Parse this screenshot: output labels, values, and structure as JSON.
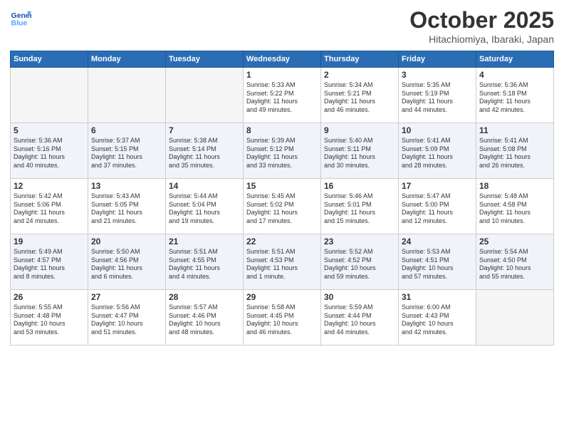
{
  "header": {
    "logo_line1": "General",
    "logo_line2": "Blue",
    "month": "October 2025",
    "location": "Hitachiomiya, Ibaraki, Japan"
  },
  "days_of_week": [
    "Sunday",
    "Monday",
    "Tuesday",
    "Wednesday",
    "Thursday",
    "Friday",
    "Saturday"
  ],
  "weeks": [
    {
      "shade": "white",
      "days": [
        {
          "num": "",
          "text": "",
          "empty": true
        },
        {
          "num": "",
          "text": "",
          "empty": true
        },
        {
          "num": "",
          "text": "",
          "empty": true
        },
        {
          "num": "1",
          "text": "Sunrise: 5:33 AM\nSunset: 5:22 PM\nDaylight: 11 hours\nand 49 minutes."
        },
        {
          "num": "2",
          "text": "Sunrise: 5:34 AM\nSunset: 5:21 PM\nDaylight: 11 hours\nand 46 minutes."
        },
        {
          "num": "3",
          "text": "Sunrise: 5:35 AM\nSunset: 5:19 PM\nDaylight: 11 hours\nand 44 minutes."
        },
        {
          "num": "4",
          "text": "Sunrise: 5:36 AM\nSunset: 5:18 PM\nDaylight: 11 hours\nand 42 minutes."
        }
      ]
    },
    {
      "shade": "shaded",
      "days": [
        {
          "num": "5",
          "text": "Sunrise: 5:36 AM\nSunset: 5:16 PM\nDaylight: 11 hours\nand 40 minutes."
        },
        {
          "num": "6",
          "text": "Sunrise: 5:37 AM\nSunset: 5:15 PM\nDaylight: 11 hours\nand 37 minutes."
        },
        {
          "num": "7",
          "text": "Sunrise: 5:38 AM\nSunset: 5:14 PM\nDaylight: 11 hours\nand 35 minutes."
        },
        {
          "num": "8",
          "text": "Sunrise: 5:39 AM\nSunset: 5:12 PM\nDaylight: 11 hours\nand 33 minutes."
        },
        {
          "num": "9",
          "text": "Sunrise: 5:40 AM\nSunset: 5:11 PM\nDaylight: 11 hours\nand 30 minutes."
        },
        {
          "num": "10",
          "text": "Sunrise: 5:41 AM\nSunset: 5:09 PM\nDaylight: 11 hours\nand 28 minutes."
        },
        {
          "num": "11",
          "text": "Sunrise: 5:41 AM\nSunset: 5:08 PM\nDaylight: 11 hours\nand 26 minutes."
        }
      ]
    },
    {
      "shade": "white",
      "days": [
        {
          "num": "12",
          "text": "Sunrise: 5:42 AM\nSunset: 5:06 PM\nDaylight: 11 hours\nand 24 minutes."
        },
        {
          "num": "13",
          "text": "Sunrise: 5:43 AM\nSunset: 5:05 PM\nDaylight: 11 hours\nand 21 minutes."
        },
        {
          "num": "14",
          "text": "Sunrise: 5:44 AM\nSunset: 5:04 PM\nDaylight: 11 hours\nand 19 minutes."
        },
        {
          "num": "15",
          "text": "Sunrise: 5:45 AM\nSunset: 5:02 PM\nDaylight: 11 hours\nand 17 minutes."
        },
        {
          "num": "16",
          "text": "Sunrise: 5:46 AM\nSunset: 5:01 PM\nDaylight: 11 hours\nand 15 minutes."
        },
        {
          "num": "17",
          "text": "Sunrise: 5:47 AM\nSunset: 5:00 PM\nDaylight: 11 hours\nand 12 minutes."
        },
        {
          "num": "18",
          "text": "Sunrise: 5:48 AM\nSunset: 4:58 PM\nDaylight: 11 hours\nand 10 minutes."
        }
      ]
    },
    {
      "shade": "shaded",
      "days": [
        {
          "num": "19",
          "text": "Sunrise: 5:49 AM\nSunset: 4:57 PM\nDaylight: 11 hours\nand 8 minutes."
        },
        {
          "num": "20",
          "text": "Sunrise: 5:50 AM\nSunset: 4:56 PM\nDaylight: 11 hours\nand 6 minutes."
        },
        {
          "num": "21",
          "text": "Sunrise: 5:51 AM\nSunset: 4:55 PM\nDaylight: 11 hours\nand 4 minutes."
        },
        {
          "num": "22",
          "text": "Sunrise: 5:51 AM\nSunset: 4:53 PM\nDaylight: 11 hours\nand 1 minute."
        },
        {
          "num": "23",
          "text": "Sunrise: 5:52 AM\nSunset: 4:52 PM\nDaylight: 10 hours\nand 59 minutes."
        },
        {
          "num": "24",
          "text": "Sunrise: 5:53 AM\nSunset: 4:51 PM\nDaylight: 10 hours\nand 57 minutes."
        },
        {
          "num": "25",
          "text": "Sunrise: 5:54 AM\nSunset: 4:50 PM\nDaylight: 10 hours\nand 55 minutes."
        }
      ]
    },
    {
      "shade": "white",
      "days": [
        {
          "num": "26",
          "text": "Sunrise: 5:55 AM\nSunset: 4:48 PM\nDaylight: 10 hours\nand 53 minutes."
        },
        {
          "num": "27",
          "text": "Sunrise: 5:56 AM\nSunset: 4:47 PM\nDaylight: 10 hours\nand 51 minutes."
        },
        {
          "num": "28",
          "text": "Sunrise: 5:57 AM\nSunset: 4:46 PM\nDaylight: 10 hours\nand 48 minutes."
        },
        {
          "num": "29",
          "text": "Sunrise: 5:58 AM\nSunset: 4:45 PM\nDaylight: 10 hours\nand 46 minutes."
        },
        {
          "num": "30",
          "text": "Sunrise: 5:59 AM\nSunset: 4:44 PM\nDaylight: 10 hours\nand 44 minutes."
        },
        {
          "num": "31",
          "text": "Sunrise: 6:00 AM\nSunset: 4:43 PM\nDaylight: 10 hours\nand 42 minutes."
        },
        {
          "num": "",
          "text": "",
          "empty": true
        }
      ]
    }
  ]
}
